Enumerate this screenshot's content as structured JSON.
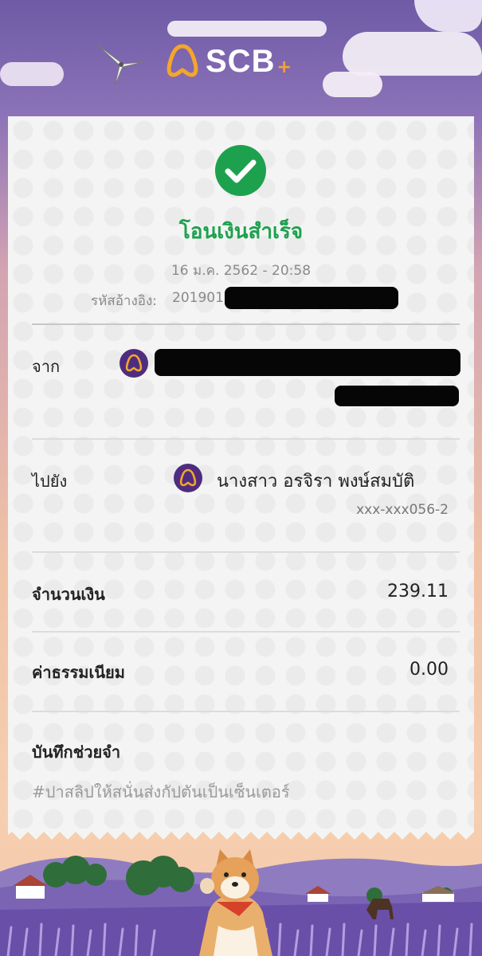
{
  "brand": {
    "name": "SCB",
    "plus": "+"
  },
  "status": {
    "title": "โอนเงินสำเร็จ",
    "datetime": "16 ม.ค. 2562 - 20:58"
  },
  "reference": {
    "label": "รหัสอ้างอิง:",
    "value": "2019011"
  },
  "from": {
    "label": "จาก"
  },
  "to": {
    "label": "ไปยัง",
    "name": "นางสาว อรจิรา พงษ์สมบัติ",
    "account": "xxx-xxx056-2"
  },
  "amount": {
    "label": "จำนวนเงิน",
    "value": "239.11"
  },
  "fee": {
    "label": "ค่าธรรมเนียม",
    "value": "0.00"
  },
  "memo": {
    "label": "บันทึกช่วยจำ",
    "text": "#ปาสลิปให้สนั่นส่งกัปตันเป็นเซ็นเตอร์"
  },
  "colors": {
    "success": "#1ea14e",
    "brand_purple": "#4e2d7f",
    "brand_gold": "#f4a62a"
  },
  "icons": {
    "success": "check-circle-icon",
    "bank": "scb-logo-icon"
  }
}
